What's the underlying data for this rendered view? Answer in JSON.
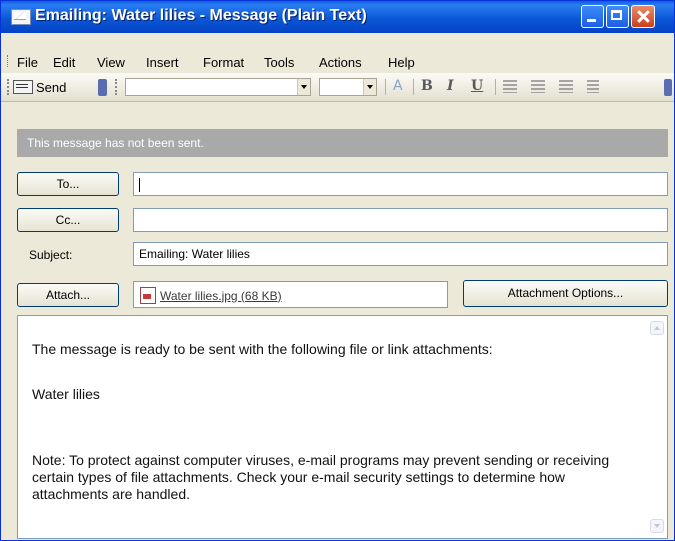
{
  "window": {
    "title": "Emailing: Water lilies - Message (Plain Text)"
  },
  "menu": [
    "File",
    "Edit",
    "View",
    "Insert",
    "Format",
    "Tools",
    "Actions",
    "Help"
  ],
  "toolbar": {
    "send_label": "Send",
    "font_value": "",
    "size_value": ""
  },
  "info_bar": "This message has not been sent.",
  "fields": {
    "to_label": "To...",
    "to_value": "",
    "cc_label": "Cc...",
    "cc_value": "",
    "subject_label": "Subject:",
    "subject_value": "Emailing: Water lilies",
    "attach_label": "Attach...",
    "attachment_name": "Water lilies.jpg (68 KB)",
    "attachment_options_label": "Attachment Options..."
  },
  "body": {
    "line1": "The message is ready to be sent with the following file or link attachments:",
    "line2": "Water lilies",
    "note": "Note: To protect against computer viruses, e-mail programs may prevent sending or receiving certain types of file attachments.  Check your e-mail security settings to determine how attachments are handled."
  },
  "colors": {
    "titlebar": "#0a58d6",
    "info_bar": "#a9a9a9",
    "window_bg": "#ece9d8"
  }
}
